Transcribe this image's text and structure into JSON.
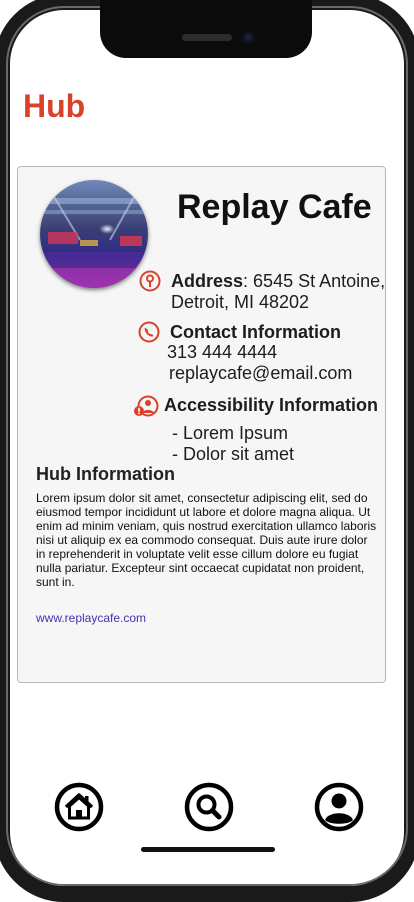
{
  "app": {
    "title": "Hub"
  },
  "venue": {
    "name": "Replay Cafe",
    "address_label": "Address",
    "address_line1": "6545 St Antoine,",
    "address_line2": "Detroit, MI 48202",
    "contact_label": "Contact Information",
    "phone": "313 444 4444",
    "email": "replaycafe@email.com",
    "accessibility_label": "Accessibility Information",
    "accessibility_items": [
      "- Lorem Ipsum",
      "- Dolor sit amet"
    ]
  },
  "hub_info": {
    "title": "Hub Information",
    "body": "Lorem ipsum dolor sit amet, consectetur adipiscing elit, sed do eiusmod tempor incididunt ut labore et dolore magna aliqua. Ut enim ad minim veniam, quis nostrud exercitation ullamco laboris nisi ut aliquip ex ea commodo consequat. Duis aute irure dolor in reprehenderit in voluptate velit esse cillum dolore eu fugiat nulla pariatur. Excepteur sint occaecat cupidatat non proident, sunt in.",
    "website": "www.replaycafe.com"
  },
  "nav": {
    "home_icon": "home-icon",
    "search_icon": "search-icon",
    "profile_icon": "profile-icon"
  },
  "colors": {
    "accent": "#d9412b",
    "link": "#4a2fb4",
    "card_bg": "#f6f6f6"
  }
}
